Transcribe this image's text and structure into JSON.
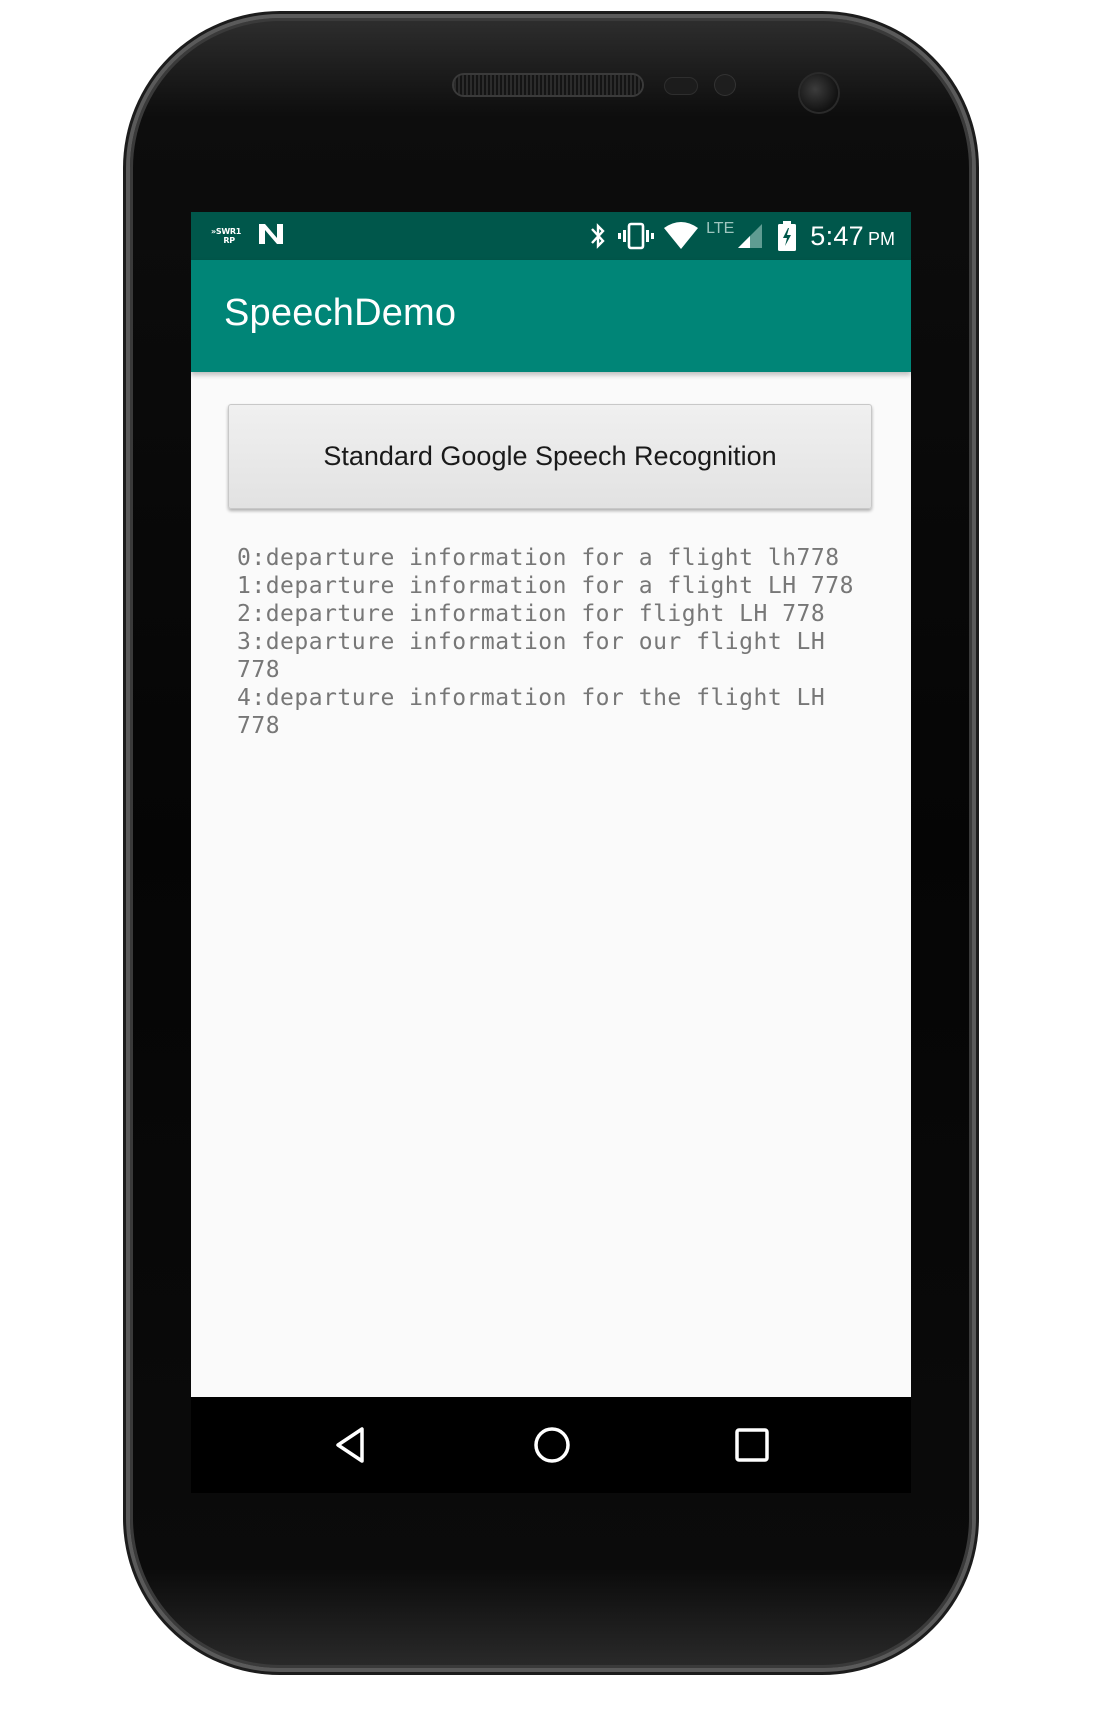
{
  "status_bar": {
    "notification_text": "»SWR1\nRP",
    "network_type": "LTE",
    "time": "5:47",
    "ampm": "PM",
    "icons": [
      "n-icon",
      "bluetooth-icon",
      "vibrate-icon",
      "wifi-icon",
      "signal-icon",
      "battery-charging-icon"
    ],
    "background": "#00574b"
  },
  "app_bar": {
    "title": "SpeechDemo",
    "background": "#008577"
  },
  "main": {
    "button_label": "Standard Google Speech Recognition",
    "results": [
      "0:departure information for a flight lh778",
      "1:departure information for a flight LH 778",
      "2:departure information for flight LH 778",
      "3:departure information for our flight LH 778",
      "4:departure information for the flight LH 778"
    ]
  },
  "nav_bar": {
    "icons": [
      "back-icon",
      "home-icon",
      "recents-icon"
    ]
  }
}
